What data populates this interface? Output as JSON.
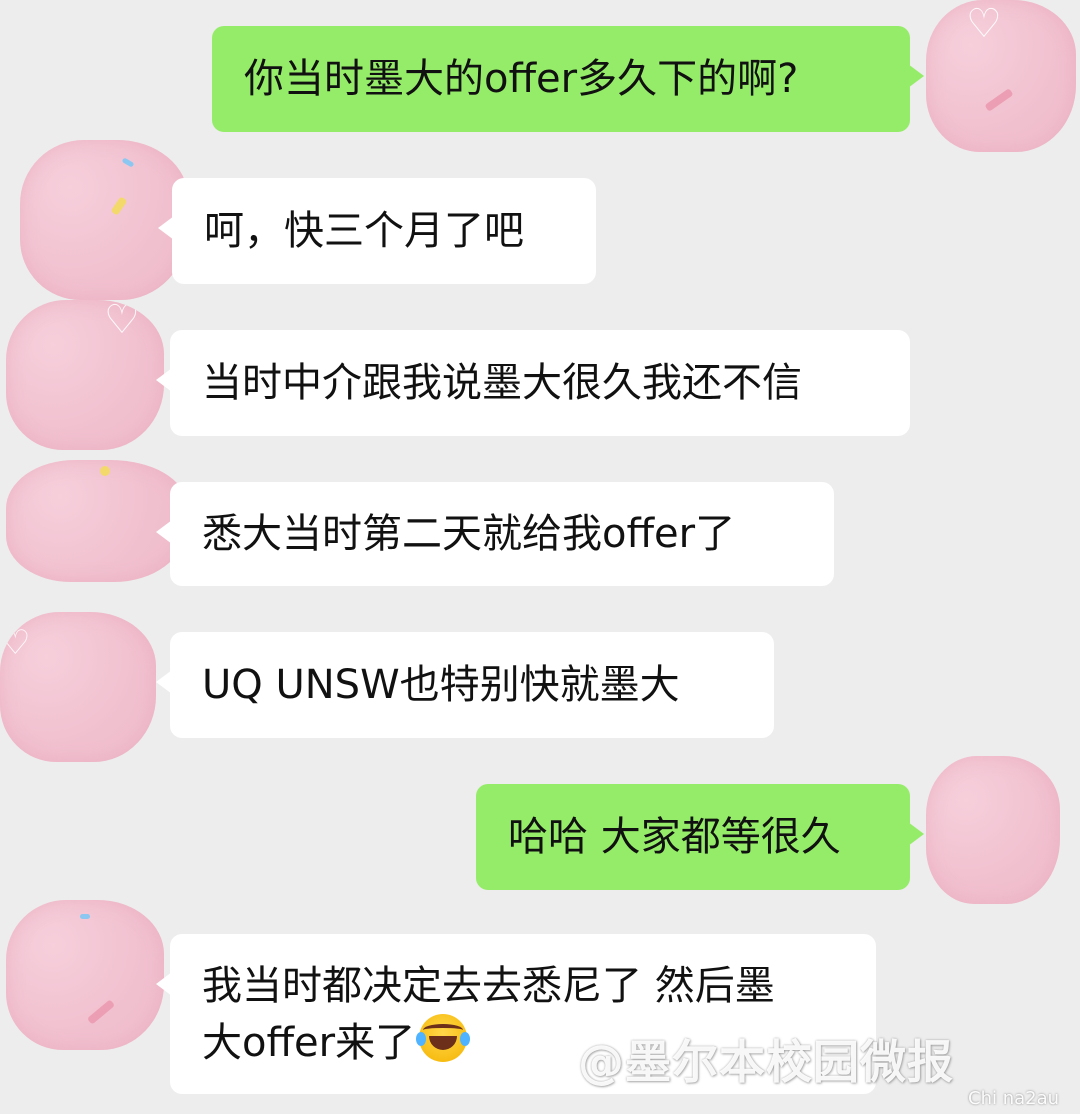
{
  "colors": {
    "background": "#ededed",
    "incoming_bubble": "#ffffff",
    "outgoing_bubble": "#95ec69",
    "avatar_blur": "#f1c0cf"
  },
  "messages": [
    {
      "direction": "outgoing",
      "text": "你当时墨大的offer多久下的啊?"
    },
    {
      "direction": "incoming",
      "text": "呵，快三个月了吧"
    },
    {
      "direction": "incoming",
      "text": "当时中介跟我说墨大很久我还不信"
    },
    {
      "direction": "incoming",
      "text": "悉大当时第二天就给我offer了"
    },
    {
      "direction": "incoming",
      "text": "UQ UNSW也特别快就墨大"
    },
    {
      "direction": "outgoing",
      "text": "哈哈 大家都等很久"
    },
    {
      "direction": "incoming",
      "text_line1": "我当时都决定去去悉尼了 然后墨",
      "text_line2": "大offer来了",
      "emoji": "face-with-tears-of-joy-icon"
    }
  ],
  "watermark": {
    "text": "@墨尔本校园微报"
  },
  "site_mark": {
    "text": "Chi na2au"
  }
}
